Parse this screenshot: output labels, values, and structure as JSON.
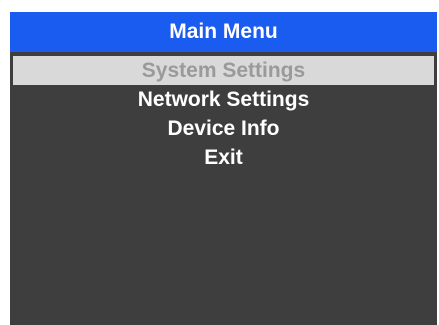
{
  "header": {
    "title": "Main Menu"
  },
  "menu": {
    "items": [
      {
        "label": "System Settings",
        "selected": true
      },
      {
        "label": "Network Settings",
        "selected": false
      },
      {
        "label": "Device Info",
        "selected": false
      },
      {
        "label": "Exit",
        "selected": false
      }
    ]
  },
  "colors": {
    "title_bar": "#1a5bf0",
    "background": "#3e3e3e",
    "selected_background": "#d9d9d9",
    "selected_text": "#9a9a9a",
    "text": "#ffffff"
  }
}
